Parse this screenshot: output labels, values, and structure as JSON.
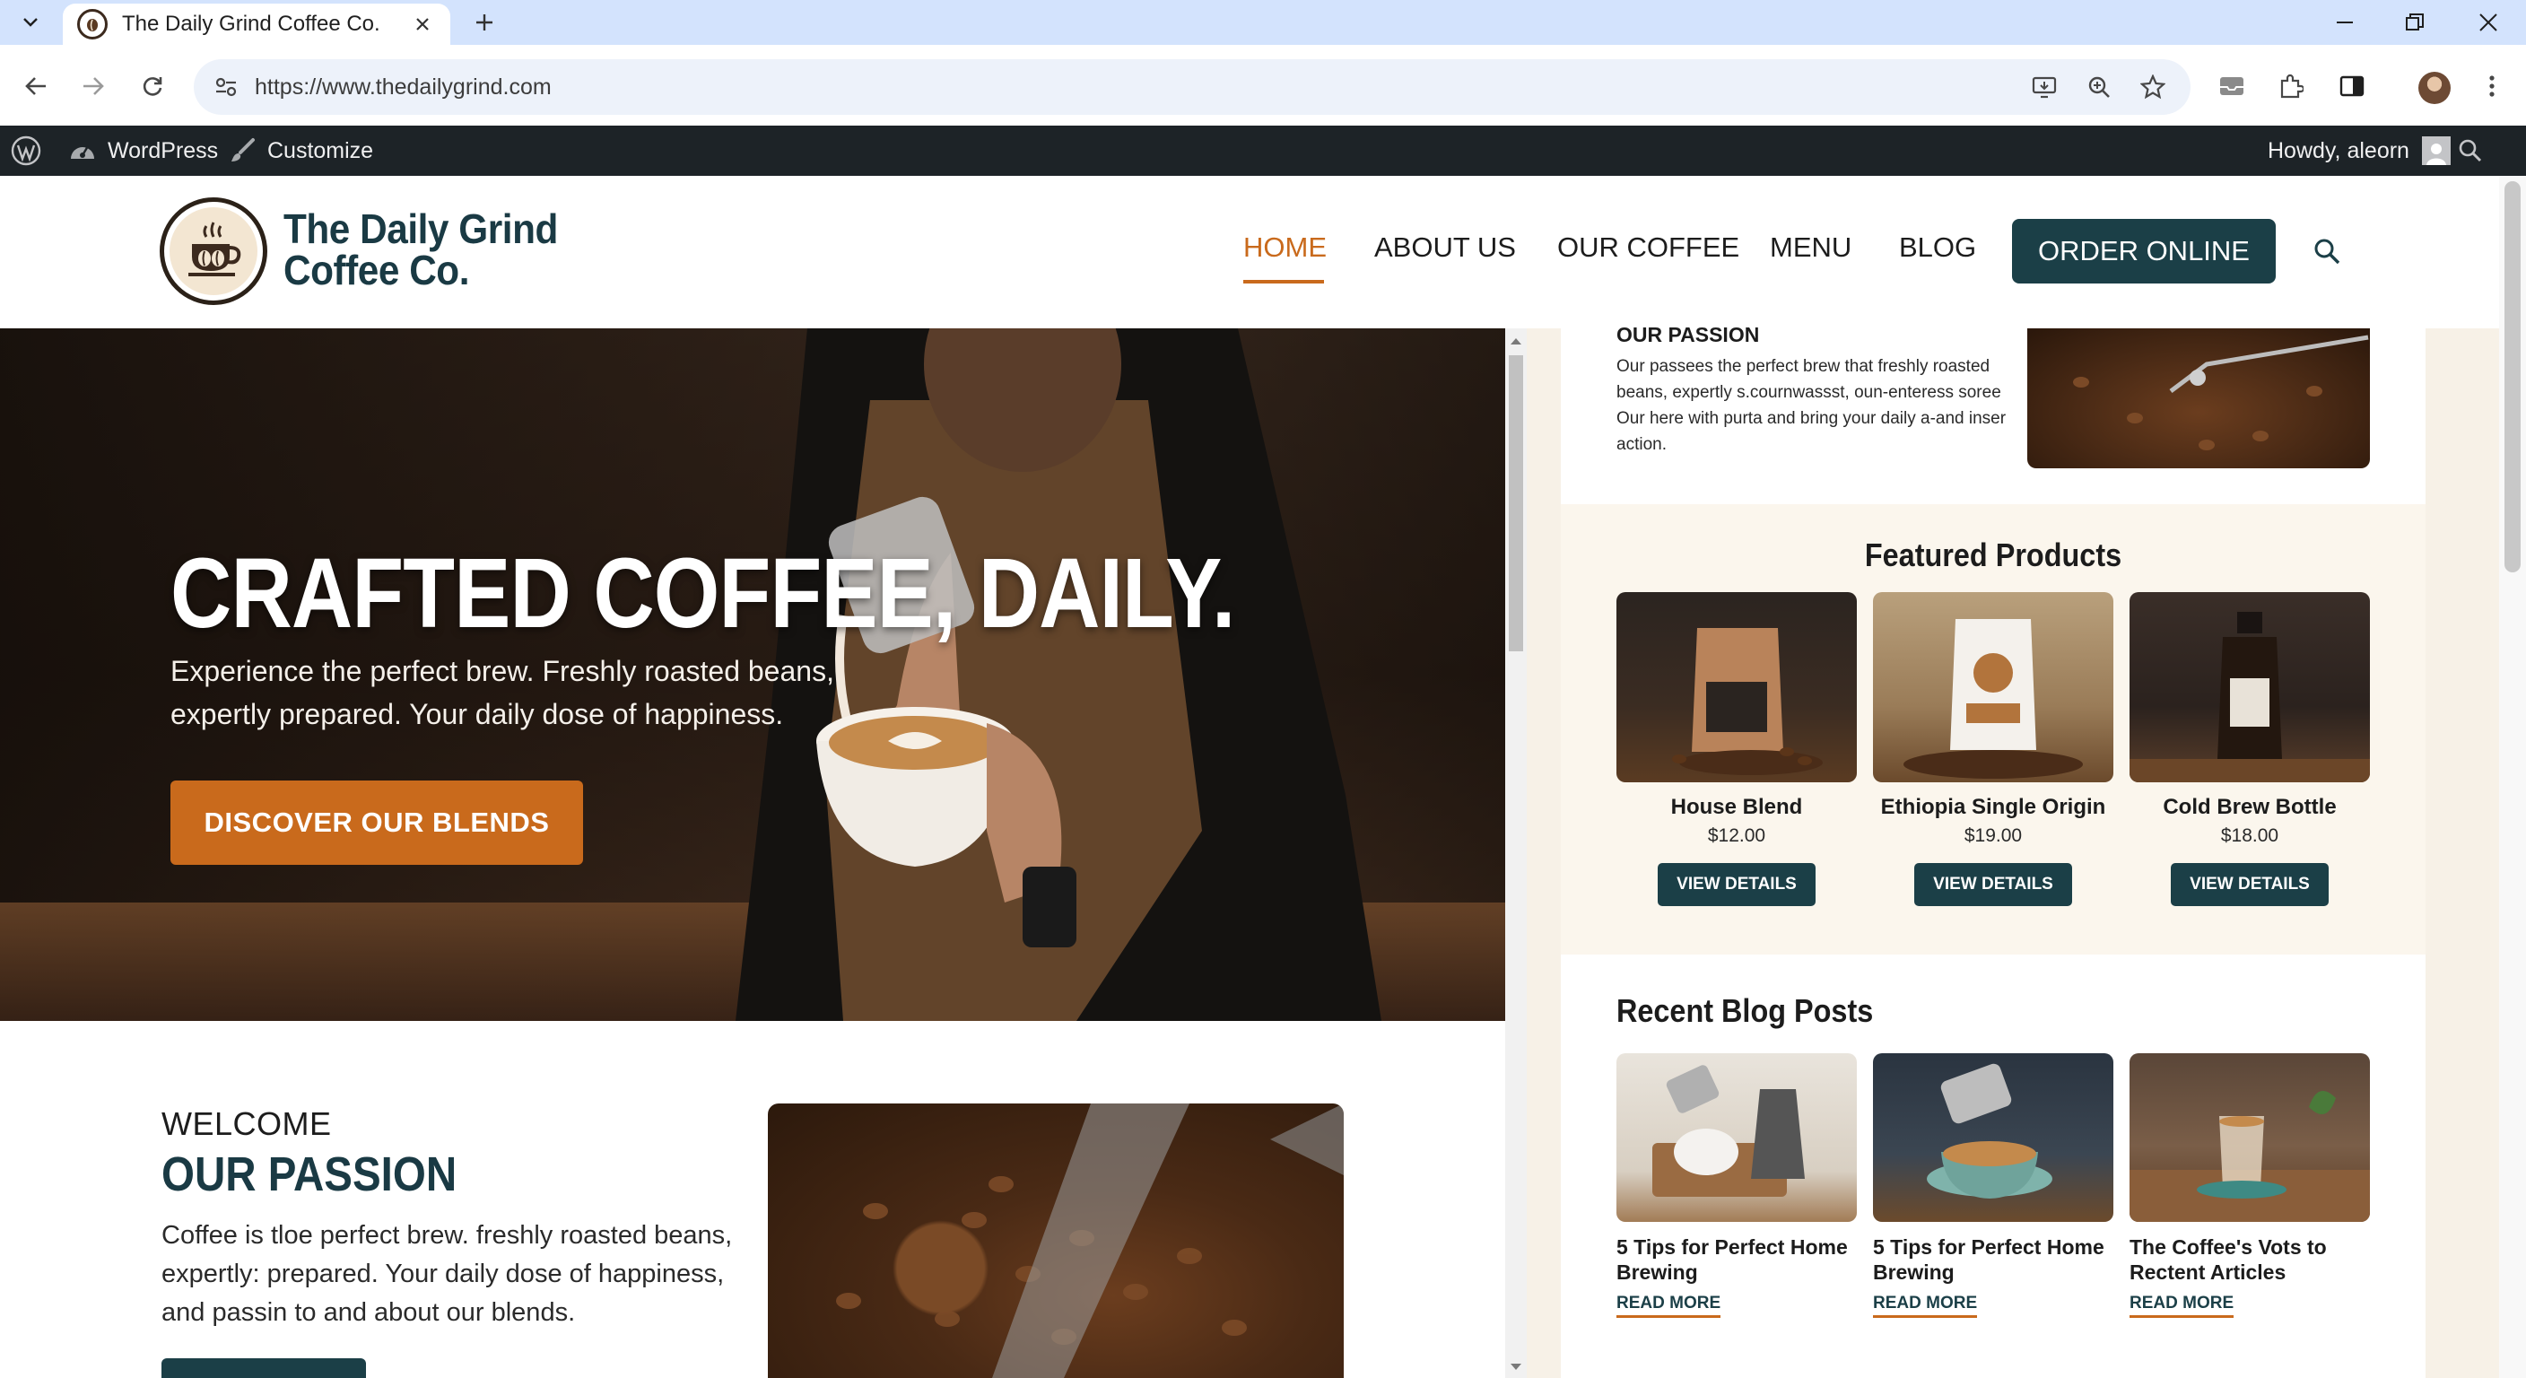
{
  "browser": {
    "tab_title": "The Daily Grind Coffee Co.",
    "url": "https://www.thedailygrind.com"
  },
  "adminbar": {
    "wordpress": "WordPress",
    "customize": "Customize",
    "howdy": "Howdy, aleorn"
  },
  "header": {
    "brand_line1": "The Daily Grind",
    "brand_line2": "Coffee Co.",
    "nav": [
      "HOME",
      "ABOUT US",
      "OUR COFFEE",
      "MENU",
      "BLOG"
    ],
    "active_nav": "HOME",
    "order_button": "ORDER ONLINE"
  },
  "hero": {
    "title": "CRAFTED COFFEE, DAILY.",
    "subtitle_line1": "Experience the perfect brew. Freshly roasted beans,",
    "subtitle_line2": "expertly prepared. Your daily dose of happiness.",
    "cta": "DISCOVER OUR BLENDS"
  },
  "welcome": {
    "kicker": "WELCOME",
    "title": "OUR PASSION",
    "body_line1": "Coffee is tloe perfect brew. freshly roasted beans,",
    "body_line2": "expertly: prepared. Your daily dose of happiness,",
    "body_line3": "and passin to and about our blends."
  },
  "right_panel": {
    "passion_title": "OUR PASSION",
    "passion_body": "Our passees the perfect brew that freshly roasted beans, expertly s.cournwassst, oun-enteress soree Our here with purta and bring your daily a-and inser action.",
    "featured_title": "Featured Products",
    "products": [
      {
        "name": "House Blend",
        "price": "$12.00",
        "button": "VIEW DETAILS"
      },
      {
        "name": "Ethiopia Single Origin",
        "price": "$19.00",
        "button": "VIEW DETAILS"
      },
      {
        "name": "Cold Brew Bottle",
        "price": "$18.00",
        "button": "VIEW DETAILS"
      }
    ],
    "blog_title": "Recent Blog Posts",
    "posts": [
      {
        "title": "5 Tips for Perfect Home Brewing",
        "link": "READ MORE"
      },
      {
        "title": "5 Tips for Perfect Home Brewing",
        "link": "READ MORE"
      },
      {
        "title": "The Coffee's Vots to Rectent Articles",
        "link": "READ MORE"
      }
    ]
  },
  "colors": {
    "brand_dark": "#1b3f47",
    "accent": "#c96a1c",
    "panel_bg": "#fbf6ed"
  }
}
